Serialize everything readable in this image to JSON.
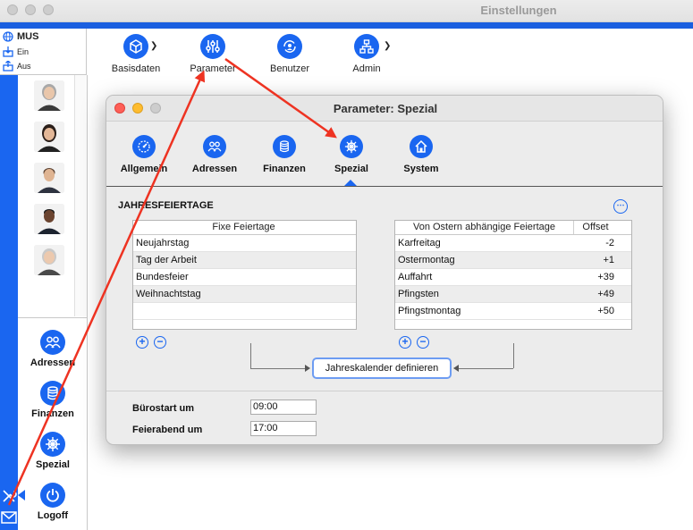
{
  "window": {
    "title": "Einstellungen"
  },
  "login": {
    "name": "MUS",
    "ein": "Ein",
    "aus": "Aus"
  },
  "toolbar": {
    "items": [
      {
        "label": "Basisdaten",
        "icon": "cube-icon"
      },
      {
        "label": "Parameter",
        "icon": "sliders-icon"
      },
      {
        "label": "Benutzer",
        "icon": "user-refresh-icon"
      },
      {
        "label": "Admin",
        "icon": "hierarchy-icon"
      }
    ]
  },
  "sidebar": {
    "buttons": [
      {
        "label": "Adressen",
        "icon": "people-icon"
      },
      {
        "label": "Finanzen",
        "icon": "coins-icon"
      },
      {
        "label": "Spezial",
        "icon": "helm-icon"
      },
      {
        "label": "Logoff",
        "icon": "power-icon"
      }
    ]
  },
  "dialog": {
    "title": "Parameter: Spezial",
    "tabs": [
      {
        "label": "Allgemein",
        "icon": "gauge-icon"
      },
      {
        "label": "Adressen",
        "icon": "people-icon"
      },
      {
        "label": "Finanzen",
        "icon": "coins-icon"
      },
      {
        "label": "Spezial",
        "icon": "helm-icon",
        "active": true
      },
      {
        "label": "System",
        "icon": "house-icon"
      }
    ],
    "section_title": "JAHRESFEIERTAGE",
    "fixed_table": {
      "header": "Fixe Feiertage",
      "rows": [
        "Neujahrstag",
        "Tag der Arbeit",
        "Bundesfeier",
        "Weihnachtstag",
        ""
      ]
    },
    "easter_table": {
      "header_name": "Von Ostern abhängige Feiertage",
      "header_offset": "Offset",
      "rows": [
        {
          "name": "Karfreitag",
          "offset": "-2"
        },
        {
          "name": "Ostermontag",
          "offset": "+1"
        },
        {
          "name": "Auffahrt",
          "offset": "+39"
        },
        {
          "name": "Pfingsten",
          "offset": "+49"
        },
        {
          "name": "Pfingstmontag",
          "offset": "+50"
        }
      ]
    },
    "calendar_button": "Jahreskalender definieren",
    "office_start_label": "Bürostart um",
    "office_start_value": "09:00",
    "office_end_label": "Feierabend um",
    "office_end_value": "17:00"
  },
  "colors": {
    "accent": "#1a66f0",
    "arrow": "#ee3322"
  }
}
